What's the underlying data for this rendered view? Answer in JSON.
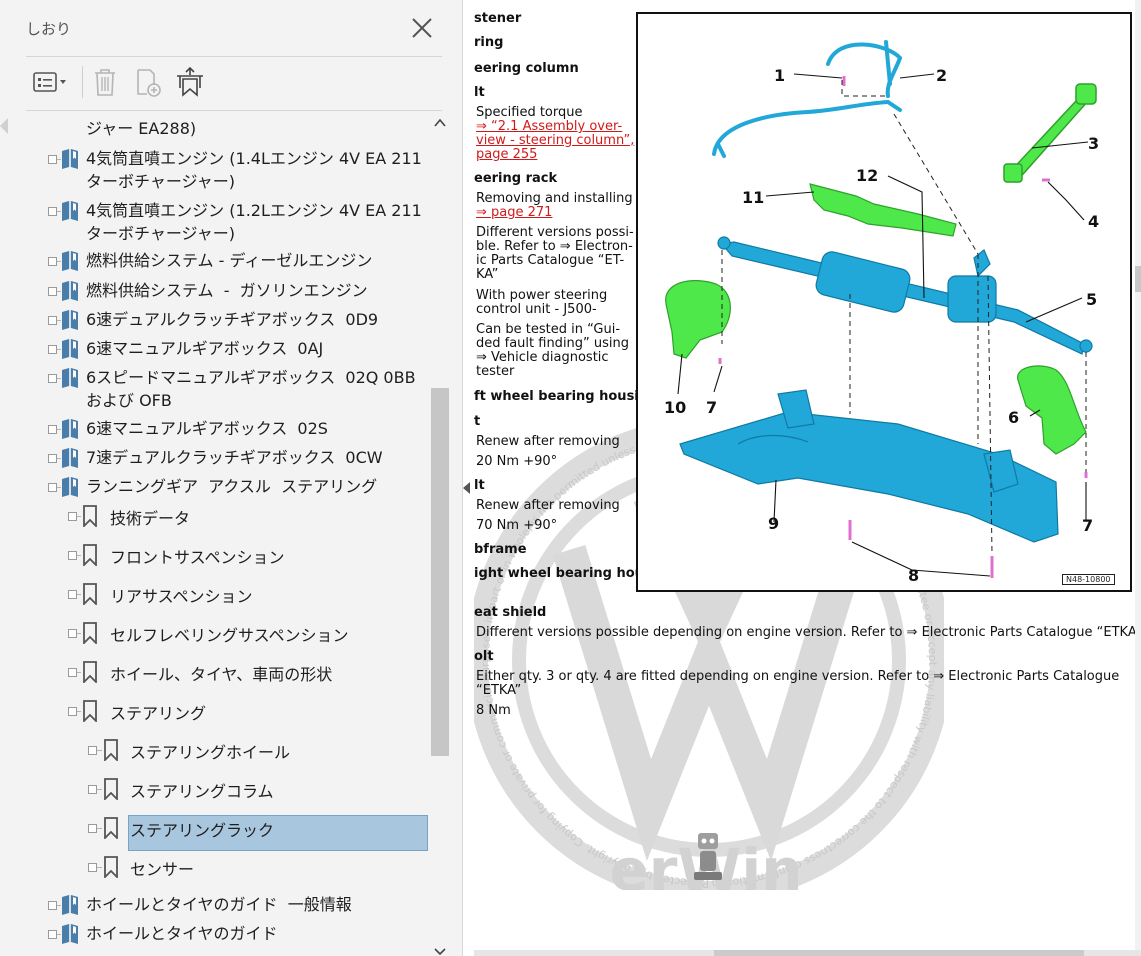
{
  "panel": {
    "title": "しおり",
    "icons": {
      "close": "close-icon",
      "options": "bookmark-options-icon",
      "delete": "trash-icon",
      "new_bookmark": "new-bookmark-icon",
      "expand_bookmark": "expand-current-bookmark-icon"
    }
  },
  "tree": {
    "items": [
      {
        "label": "ジャー EA288)",
        "level": 0,
        "partial": true
      },
      {
        "label": "4気筒直噴エンジン (1.4Lエンジン 4V EA 211 ターボチャージャー)",
        "level": 0
      },
      {
        "label": "4気筒直噴エンジン (1.2Lエンジン 4V EA 211 ターボチャージャー)",
        "level": 0
      },
      {
        "label": "燃料供給システム - ディーゼルエンジン",
        "level": 0
      },
      {
        "label": "燃料供給システム  -  ガソリンエンジン",
        "level": 0
      },
      {
        "label": "6速デュアルクラッチギアボックス  0D9",
        "level": 0
      },
      {
        "label": "6速マニュアルギアボックス  0AJ",
        "level": 0
      },
      {
        "label": "6スピードマニュアルギアボックス  02Q 0BB および OFB",
        "level": 0
      },
      {
        "label": "6速マニュアルギアボックス  02S",
        "level": 0
      },
      {
        "label": "7速デュアルクラッチギアボックス  0CW",
        "level": 0
      },
      {
        "label": "ランニングギア  アクスル  ステアリング",
        "level": 0
      },
      {
        "label": "技術データ",
        "level": 1
      },
      {
        "label": "フロントサスペンション",
        "level": 1
      },
      {
        "label": "リアサスペンション",
        "level": 1
      },
      {
        "label": "セルフレベリングサスペンション",
        "level": 1
      },
      {
        "label": "ホイール、タイヤ、車両の形状",
        "level": 1
      },
      {
        "label": "ステアリング",
        "level": 1
      },
      {
        "label": "ステアリングホイール",
        "level": 2
      },
      {
        "label": "ステアリングコラム",
        "level": 2
      },
      {
        "label": "ステアリングラック",
        "level": 2,
        "selected": true
      },
      {
        "label": "センサー",
        "level": 2
      },
      {
        "label": "ホイールとタイヤのガイド  一般情報",
        "level": 0
      },
      {
        "label": "ホイールとタイヤのガイド",
        "level": 0
      }
    ]
  },
  "doc": {
    "left_text": [
      {
        "text": "stener",
        "bold": true
      },
      {
        "text": "ring",
        "bold": true
      },
      {
        "text": "eering column",
        "bold": true
      },
      {
        "text": "lt",
        "bold": true
      },
      {
        "text": "Specified torque"
      },
      {
        "text": "⇒ “2.1 Assembly over-",
        "link": true
      },
      {
        "text": "view - steering column”,",
        "link": true
      },
      {
        "text": "page 255",
        "link": true
      },
      {
        "text": "eering rack",
        "bold": true
      },
      {
        "text": "Removing and installing"
      },
      {
        "text": "⇒ page 271",
        "link": true
      },
      {
        "text": "Different versions possi-"
      },
      {
        "text": "ble. Refer to ⇒  Electron-"
      },
      {
        "text": "ic Parts Catalogue “ET-"
      },
      {
        "text": "KA”"
      },
      {
        "text": "With power steering"
      },
      {
        "text": "control unit - J500-"
      },
      {
        "text": "Can be tested in “Gui-"
      },
      {
        "text": "ded fault finding” using"
      },
      {
        "text": "⇒ Vehicle diagnostic"
      },
      {
        "text": "tester"
      },
      {
        "text": "ft wheel bearing housing",
        "bold": true
      },
      {
        "text": "t",
        "bold": true
      },
      {
        "text": "Renew after removing"
      },
      {
        "text": "20 Nm +90°"
      },
      {
        "text": "lt",
        "bold": true
      },
      {
        "text": "Renew after removing"
      },
      {
        "text": "70 Nm +90°"
      },
      {
        "text": "bframe",
        "bold": true
      },
      {
        "text": "ight wheel bearing hous-",
        "bold": true
      },
      {
        "text": "eat shield",
        "bold": true
      },
      {
        "text": "Different versions possible depending on engine version. Refer to ⇒  Electronic Parts Catalogue “ETKA”"
      },
      {
        "text": "olt",
        "bold": true
      },
      {
        "text": "Either qty. 3 or qty. 4 are fitted depending on engine version. Refer to ⇒  Electronic Parts Catalogue"
      },
      {
        "text": "“ETKA”"
      },
      {
        "text": "8 Nm"
      }
    ],
    "diagram": {
      "callouts": [
        "1",
        "2",
        "3",
        "4",
        "5",
        "6",
        "7",
        "7",
        "8",
        "9",
        "10",
        "11",
        "12"
      ],
      "figure_id": "N48-10800",
      "colors": {
        "cyan": "#21a8d8",
        "green": "#4fe84a",
        "pink": "#e070d0"
      }
    },
    "watermark": {
      "ring_text": "Protected by copyright. Copying for private or commercial purposes, in part or in whole, is not permitted unless authorised by Volkswagen AG. Volkswagen AG does not guarantee or accept any liability with respect to the correctness of information in this document. Copyright by Volkswagen AG.",
      "brand": "erWin",
      "color": "#d6d6d6"
    }
  }
}
